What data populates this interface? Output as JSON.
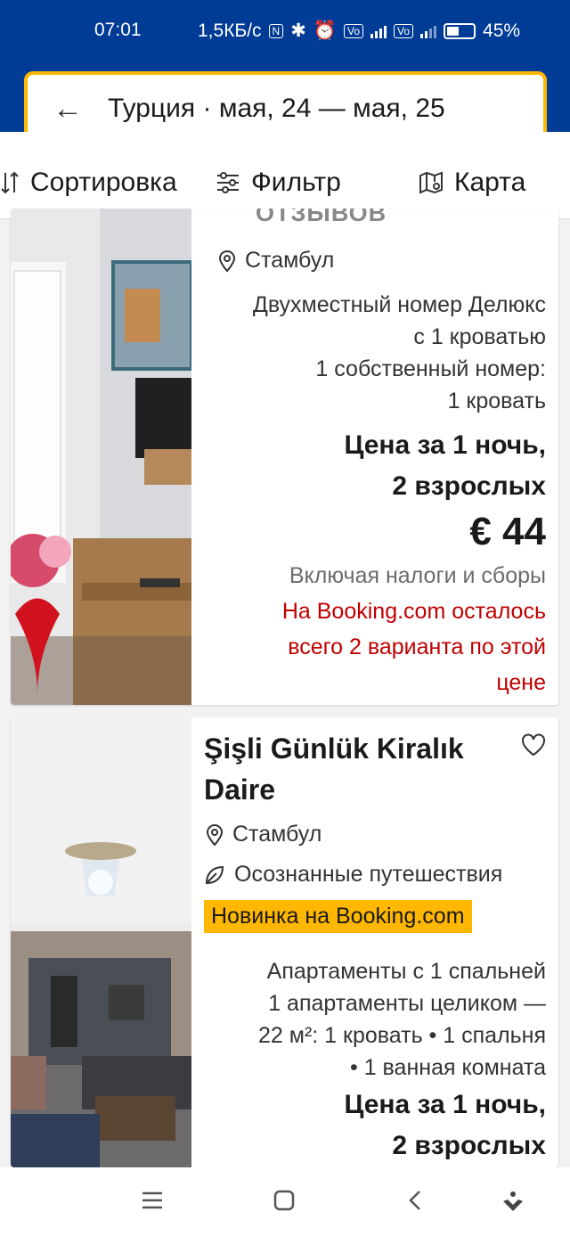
{
  "status_bar": {
    "time": "07:01",
    "speed": "1,5КБ/с",
    "battery": "45%"
  },
  "search": {
    "query": "Турция · мая, 24 — мая, 25"
  },
  "toolbar": {
    "sort_label": "Сортировка",
    "filter_label": "Фильтр",
    "map_label": "Карта"
  },
  "listings": [
    {
      "partial_header": "отзывов",
      "location": "Стамбул",
      "room_type_line1": "Двухместный номер Делюкс",
      "room_type_line2": "с 1 кроватью",
      "units_line1": "1 собственный номер:",
      "units_line2": "1 кровать",
      "price_label_line1": "Цена за 1 ночь,",
      "price_label_line2": "2 взрослых",
      "price": "€ 44",
      "taxes": "Включая налоги и сборы",
      "scarcity_line1": "На Booking.com осталось",
      "scarcity_line2": "всего 2 варианта по этой",
      "scarcity_line3": "цене"
    },
    {
      "title_line1": "Şişli Günlük Kiralık",
      "title_line2": "Daire",
      "location": "Стамбул",
      "sustainability": "Осознанные путешествия",
      "badge": "Новинка на Booking.com",
      "room_type": "Апартаменты с 1 спальней",
      "units_line1": "1 апартаменты целиком —",
      "units_line2": "22 м²: 1 кровать  •  1 спальня",
      "units_line3": "•  1 ванная комната",
      "price_label_line1": "Цена за 1 ночь,",
      "price_label_line2": "2 взрослых"
    }
  ],
  "colors": {
    "header_blue": "#003b95",
    "search_border": "#ffb700",
    "scarcity_red": "#c00000",
    "badge_yellow": "#ffb700"
  }
}
